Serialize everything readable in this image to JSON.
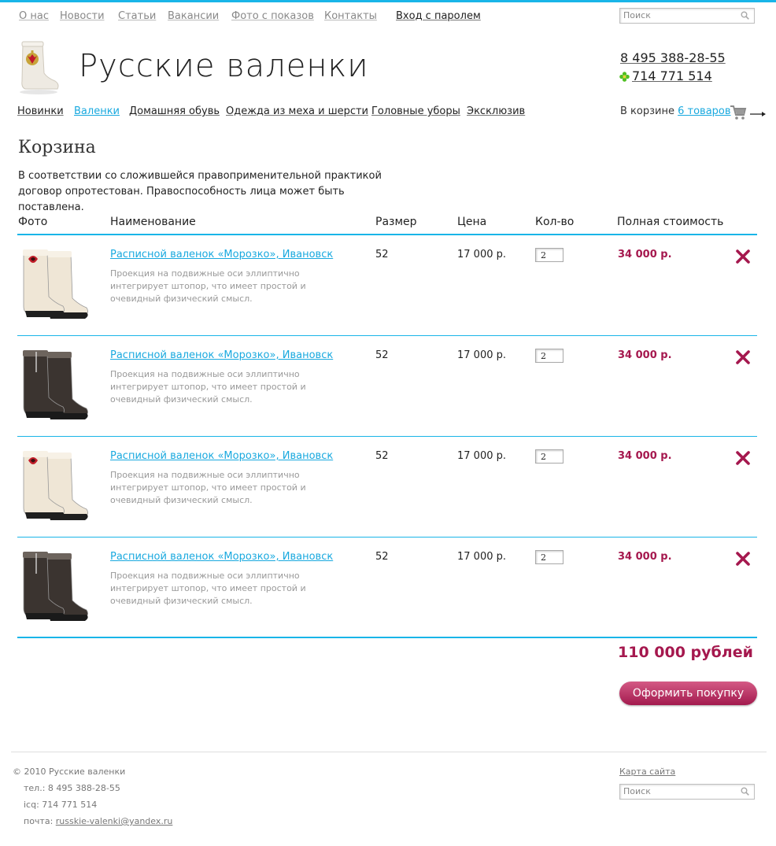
{
  "top_nav": [
    {
      "label": "О нас"
    },
    {
      "label": "Новости"
    },
    {
      "label": "Статьи"
    },
    {
      "label": "Вакансии"
    },
    {
      "label": "Фото с показов"
    },
    {
      "label": "Контакты"
    }
  ],
  "login_label": "Вход с паролем",
  "search": {
    "placeholder": "Поиск"
  },
  "header": {
    "site_title": "Русские валенки",
    "phone": "8 495 388-28-55",
    "icq": "714 771 514"
  },
  "main_nav": [
    {
      "label": "Новинки",
      "active": false
    },
    {
      "label": "Валенки",
      "active": true
    },
    {
      "label": "Домашняя обувь",
      "active": false
    },
    {
      "label": "Одежда из меха и шерсти",
      "active": false
    },
    {
      "label": "Головные уборы",
      "active": false
    },
    {
      "label": "Эксклюзив",
      "active": false
    }
  ],
  "cart_status": {
    "prefix": "В корзине",
    "count": "6 товаров"
  },
  "page": {
    "title": "Корзина",
    "intro": "В соответствии со сложившейся правоприменительной практикой договор опротестован. Правоспособность лица может быть поставлена."
  },
  "table": {
    "headers": {
      "photo": "Фото",
      "name": "Наименование",
      "size": "Размер",
      "price": "Цена",
      "qty": "Кол-во",
      "total": "Полная стоимость"
    },
    "rows": [
      {
        "name": "Расписной валенок «Морозко», Ивановск",
        "desc": "Проекция на подвижные оси эллиптично интегрирует штопор, что имеет простой и очевидный физический смысл.",
        "size": "52",
        "price": "17 000 р.",
        "qty": "2",
        "total": "34 000 р.",
        "photo_style": "white"
      },
      {
        "name": "Расписной валенок «Морозко», Ивановск",
        "desc": "Проекция на подвижные оси эллиптично интегрирует штопор, что имеет простой и очевидный физический смысл.",
        "size": "52",
        "price": "17 000 р.",
        "qty": "2",
        "total": "34 000 р.",
        "photo_style": "dark"
      },
      {
        "name": "Расписной валенок «Морозко», Ивановск",
        "desc": "Проекция на подвижные оси эллиптично интегрирует штопор, что имеет простой и очевидный физический смысл.",
        "size": "52",
        "price": "17 000 р.",
        "qty": "2",
        "total": "34 000 р.",
        "photo_style": "white"
      },
      {
        "name": "Расписной валенок «Морозко», Ивановск",
        "desc": "Проекция на подвижные оси эллиптично интегрирует штопор, что имеет простой и очевидный физический смысл.",
        "size": "52",
        "price": "17 000 р.",
        "qty": "2",
        "total": "34 000 р.",
        "photo_style": "dark"
      }
    ]
  },
  "grand_total": "110 000 рублей",
  "checkout_label": "Оформить покупку",
  "footer": {
    "copyright": "© 2010 Русские валенки",
    "tel_label": "тел.:",
    "tel": "8 495 388-28-55",
    "icq_label": "icq:",
    "icq": "714 771 514",
    "mail_label": "почта:",
    "mail": "russkie-valenki@yandex.ru",
    "sitemap": "Карта сайта"
  },
  "colors": {
    "accent": "#19b5e8",
    "link": "#19a9df",
    "price": "#a5184e"
  },
  "icons": [
    "search-icon",
    "logo-boot-icon",
    "icq-flower-icon",
    "cart-icon",
    "arrow-right-icon",
    "remove-icon",
    "boot-photo-icon"
  ]
}
